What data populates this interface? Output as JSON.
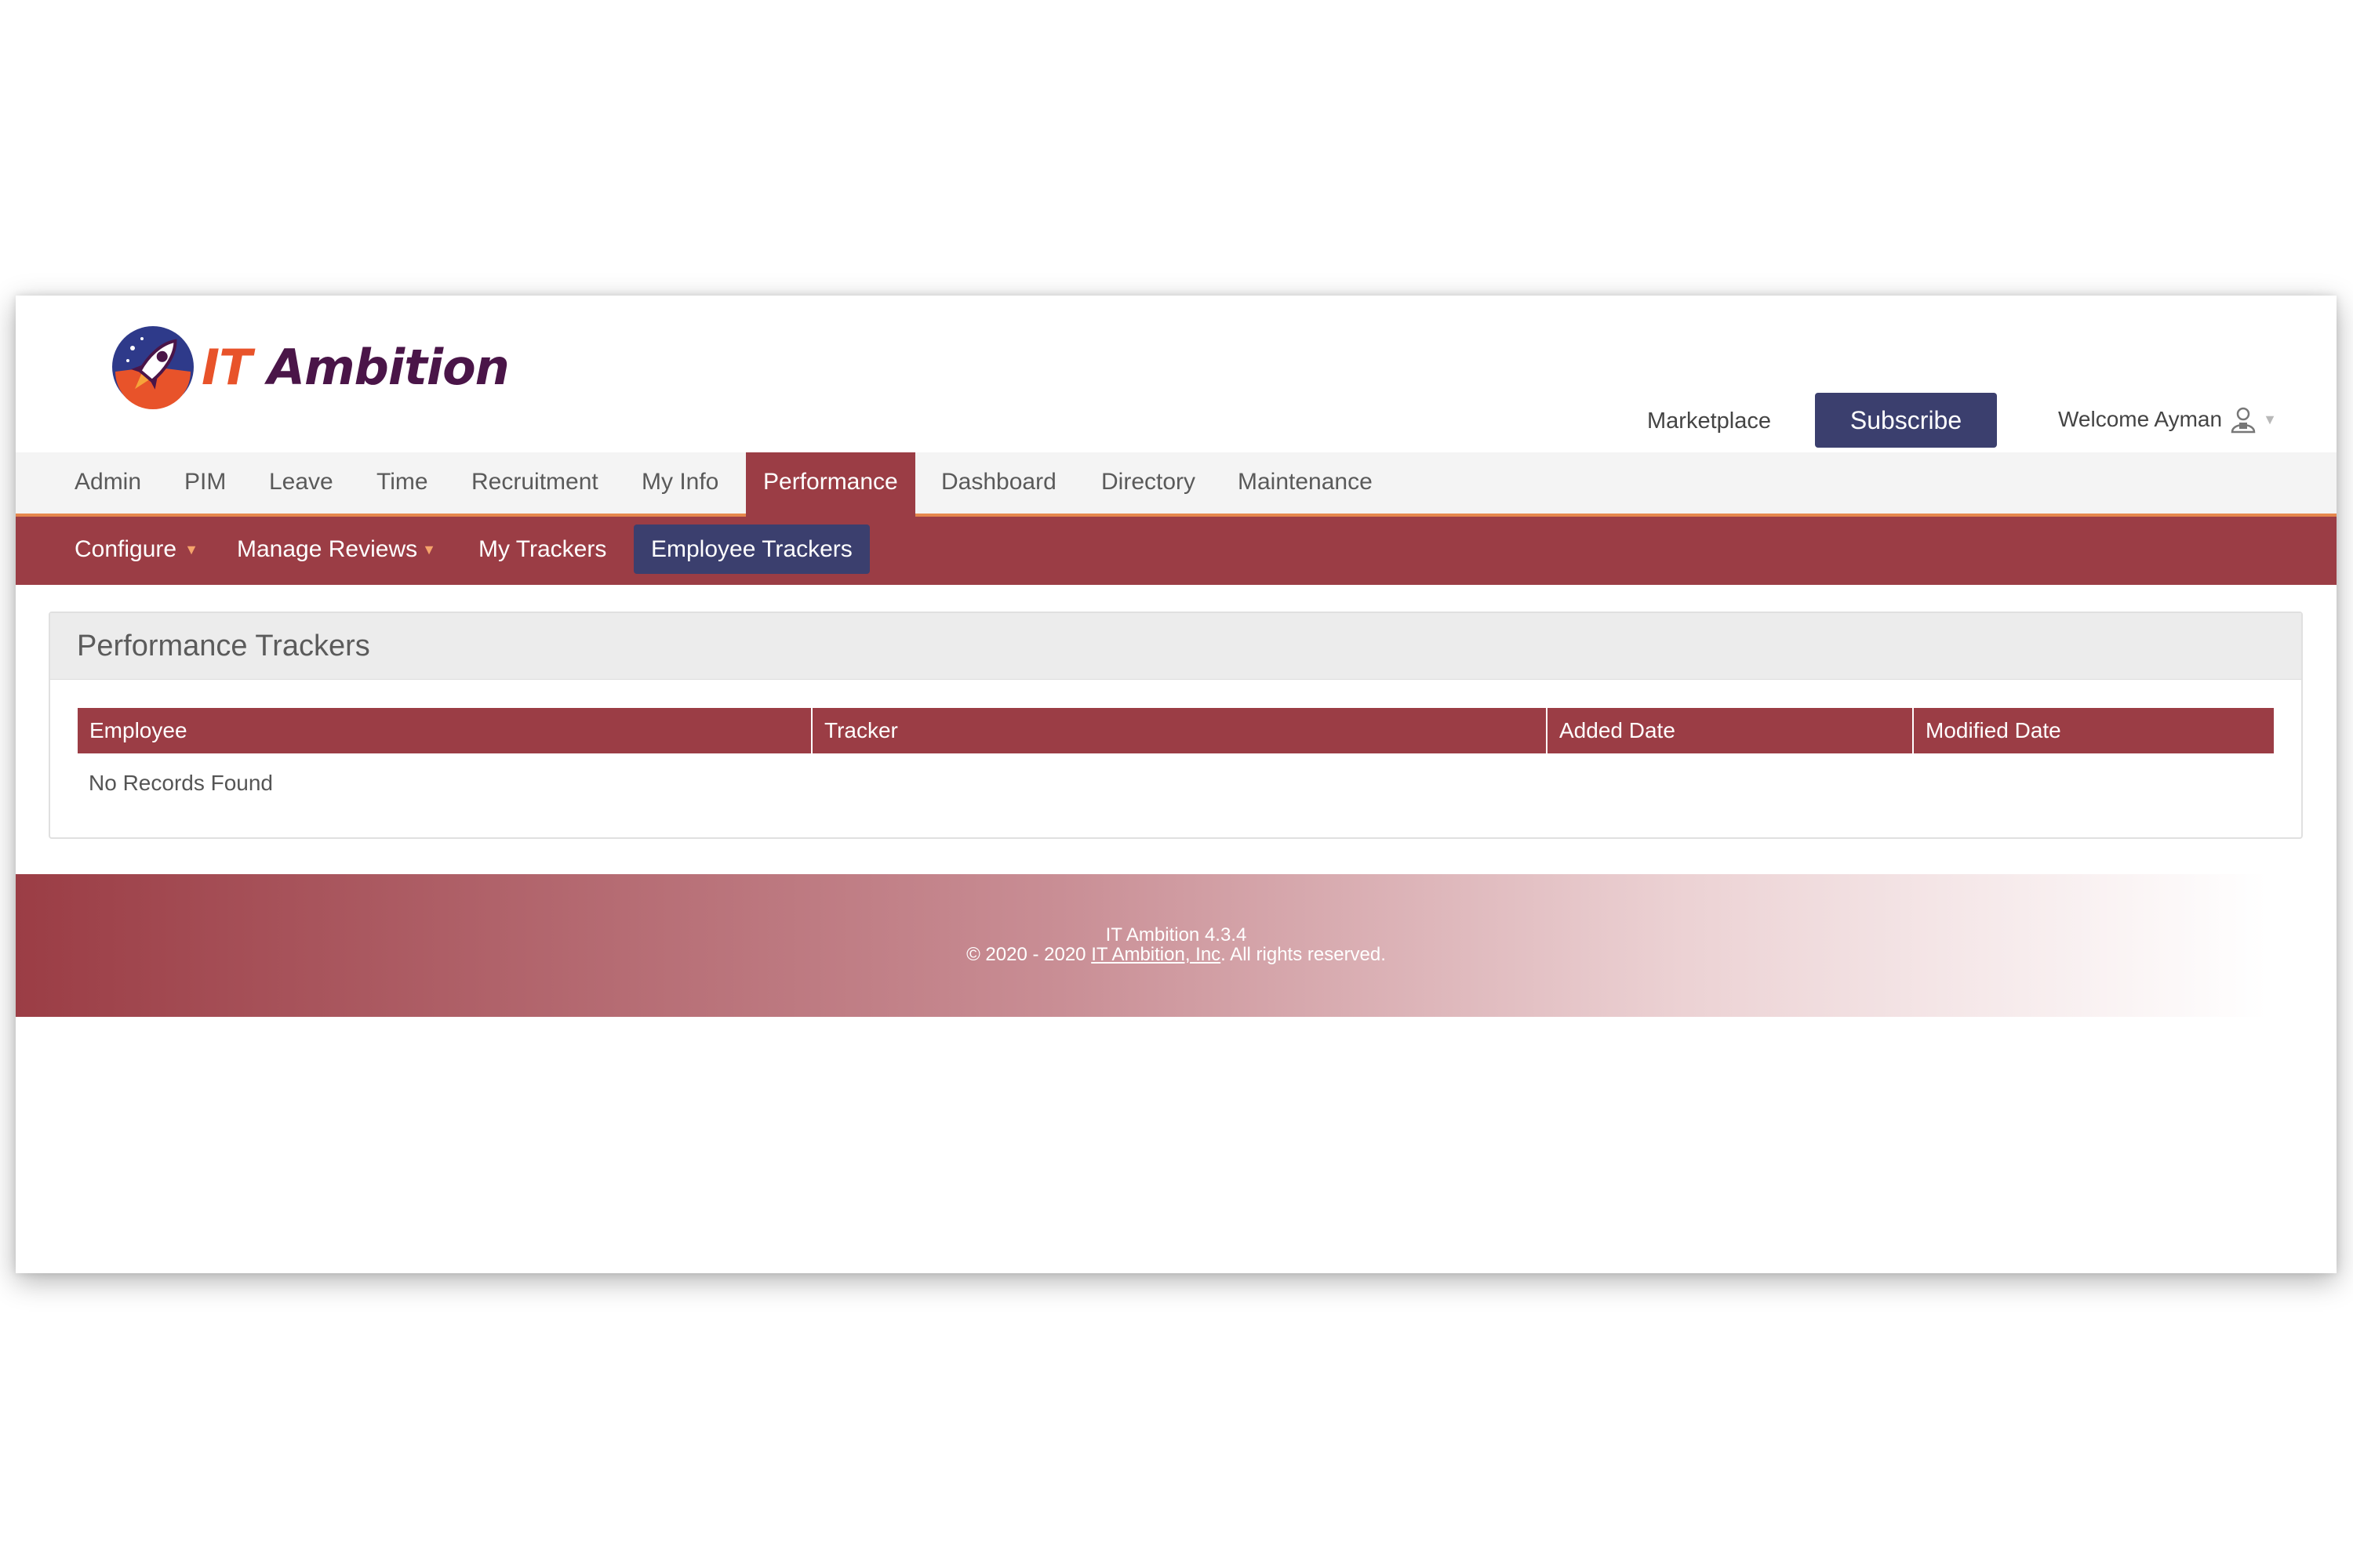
{
  "header": {
    "logo_text_it": "IT",
    "logo_text_rest": "Ambition",
    "marketplace": "Marketplace",
    "subscribe": "Subscribe",
    "welcome": "Welcome Ayman",
    "user_icon": "user-icon"
  },
  "main_menu": {
    "admin": "Admin",
    "pim": "PIM",
    "leave": "Leave",
    "time": "Time",
    "recruitment": "Recruitment",
    "my_info": "My Info",
    "performance": "Performance",
    "dashboard": "Dashboard",
    "directory": "Directory",
    "maintenance": "Maintenance",
    "active": "Performance"
  },
  "sub_menu": {
    "configure": "Configure",
    "manage_reviews": "Manage Reviews",
    "my_trackers": "My Trackers",
    "employee_trackers": "Employee Trackers",
    "active": "Employee Trackers"
  },
  "panel": {
    "title": "Performance Trackers",
    "columns": [
      "Employee",
      "Tracker",
      "Added Date",
      "Modified Date"
    ],
    "empty_message": "No Records Found"
  },
  "footer": {
    "version": "IT Ambition 4.3.4",
    "copyright_prefix": "© 2020 - 2020 ",
    "company_link": "IT Ambition, Inc",
    "copyright_suffix": ". All rights reserved."
  },
  "colors": {
    "brand_red": "#9b3d45",
    "brand_navy": "#3b3f6e",
    "accent_orange": "#e6874d",
    "logo_purple": "#4a1548"
  }
}
